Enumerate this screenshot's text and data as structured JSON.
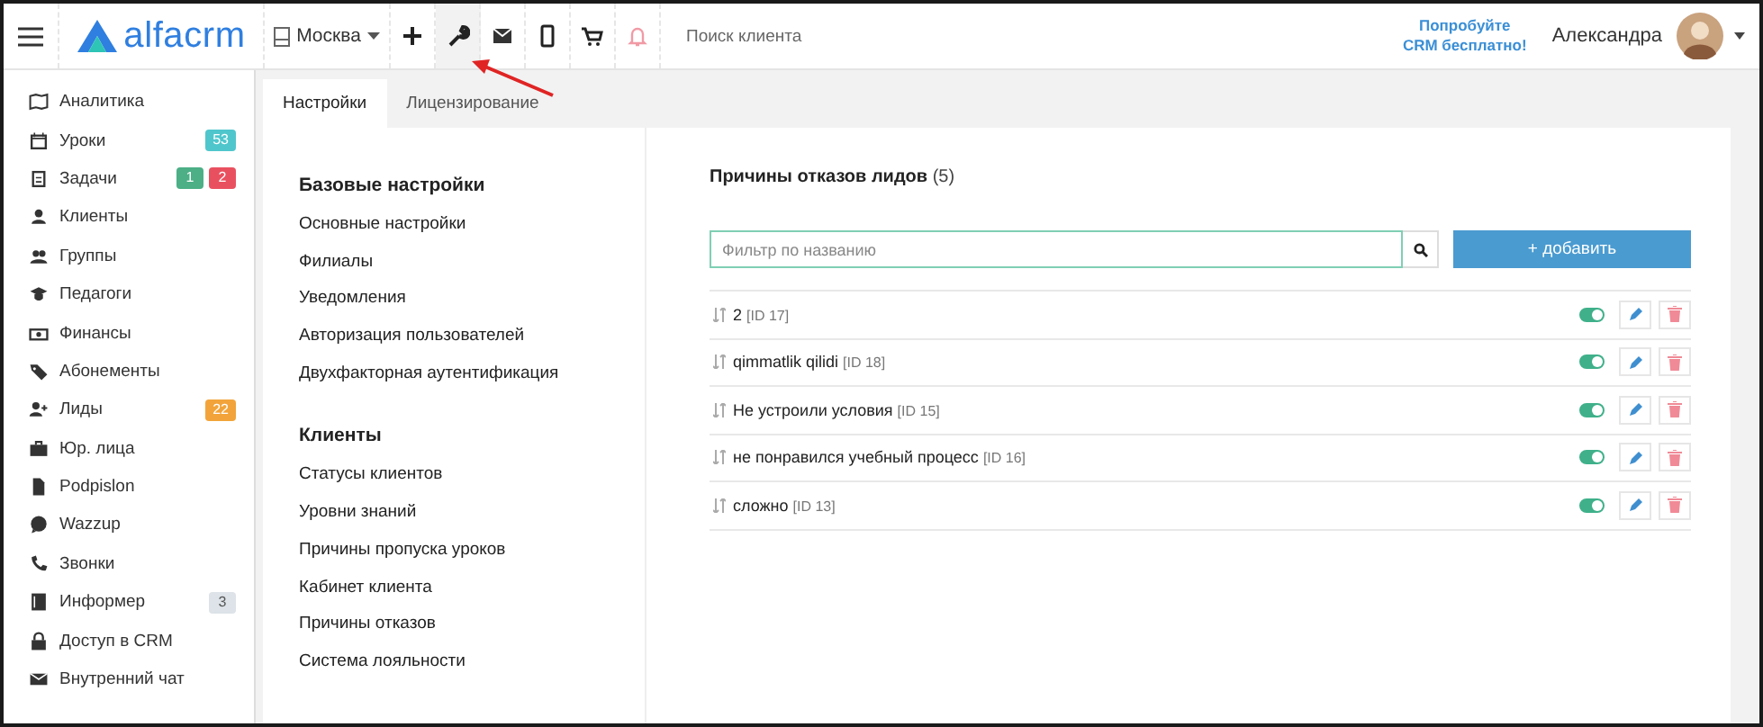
{
  "topbar": {
    "logo": "alfacrm",
    "branch": "Москва",
    "toolbar": [
      {
        "selected": false
      },
      {
        "selected": true
      },
      {
        "selected": false
      },
      {
        "selected": false
      },
      {
        "selected": false
      },
      {
        "selected": false
      }
    ],
    "search": {
      "placeholder": "Поиск клиента"
    },
    "promo": [
      "Попробуйте",
      "CRM бесплатно!"
    ],
    "user": "Александра"
  },
  "sidebar": {
    "items": [
      {
        "label": "Аналитика"
      },
      {
        "label": "Уроки",
        "badges": [
          {
            "text": "53",
            "color": "#4fc6cc"
          }
        ]
      },
      {
        "label": "Задачи",
        "badges": [
          {
            "text": "1",
            "color": "#4caf86"
          },
          {
            "text": "2",
            "color": "#e9505f"
          }
        ]
      },
      {
        "label": "Клиенты"
      },
      {
        "label": "Группы"
      },
      {
        "label": "Педагоги"
      },
      {
        "label": "Финансы"
      },
      {
        "label": "Абонементы"
      },
      {
        "label": "Лиды",
        "badges": [
          {
            "text": "22",
            "color": "#f2a43a"
          }
        ]
      },
      {
        "label": "Юр. лица"
      },
      {
        "label": "Podpislon"
      },
      {
        "label": "Wazzup"
      },
      {
        "label": "Звонки"
      },
      {
        "label": "Информер",
        "badges": [
          {
            "text": "3",
            "color": "#dde3e8"
          }
        ]
      },
      {
        "label": "Доступ в CRM"
      },
      {
        "label": "Внутренний чат"
      }
    ]
  },
  "tabs": [
    {
      "label": "Настройки",
      "selected": true
    },
    {
      "label": "Лицензирование",
      "selected": false
    }
  ],
  "settings_menu": [
    {
      "heading": "Базовые настройки",
      "items": [
        "Основные настройки",
        "Филиалы",
        "Уведомления",
        "Авторизация пользователей",
        "Двухфакторная аутентификация"
      ]
    },
    {
      "heading": "Клиенты",
      "items": [
        "Статусы клиентов",
        "Уровни знаний",
        "Причины пропуска уроков",
        "Кабинет клиента",
        "Причины отказов",
        "Система лояльности"
      ]
    }
  ],
  "content": {
    "title": "Причины отказов лидов",
    "count": "(5)",
    "filter": {
      "placeholder": "Фильтр по названию"
    },
    "add_button": "+ добавить",
    "rows": [
      {
        "name": "2",
        "id": "[ID 17]",
        "on": true
      },
      {
        "name": "qimmatlik qilidi",
        "id": "[ID 18]",
        "on": true
      },
      {
        "name": "Не устроили условия",
        "id": "[ID 15]",
        "on": true
      },
      {
        "name": "не понравился учебный процесс",
        "id": "[ID 16]",
        "on": true
      },
      {
        "name": "сложно",
        "id": "[ID 13]",
        "on": true
      }
    ]
  }
}
